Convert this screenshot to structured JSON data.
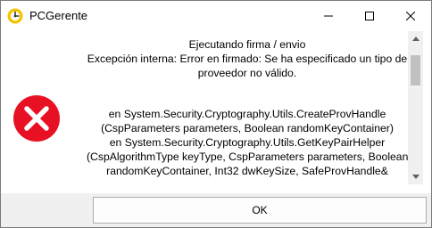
{
  "window": {
    "title": "PCGerente",
    "controls": {
      "minimize_icon": "minimize-icon",
      "maximize_icon": "maximize-icon",
      "close_icon": "close-icon"
    }
  },
  "message": {
    "icon": "error-icon",
    "lines": [
      "Ejecutando firma / envio",
      "Excepción interna: Error en firmado: Se ha especificado un tipo de",
      "proveedor no válido.",
      "",
      " en System.Security.Cryptography.Utils.CreateProvHandle",
      "(CspParameters parameters, Boolean randomKeyContainer)",
      " en System.Security.Cryptography.Utils.GetKeyPairHelper",
      "(CspAlgorithmType keyType, CspParameters parameters, Boolean",
      "randomKeyContainer, Int32 dwKeySize, SafeProvHandle&"
    ]
  },
  "buttons": {
    "ok_label": "OK"
  },
  "colors": {
    "error_red": "#e81123",
    "window_bg": "#f0f0f0",
    "content_bg": "#ffffff",
    "app_icon_yellow": "#f5c400"
  }
}
